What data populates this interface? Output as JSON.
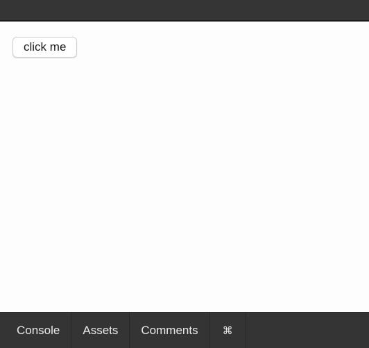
{
  "preview": {
    "button_label": "click me"
  },
  "bottom_tabs": {
    "console": "Console",
    "assets": "Assets",
    "comments": "Comments",
    "shortcuts": "⌘"
  },
  "colors": {
    "top_bar": "#353535",
    "bottom_bar": "#343434",
    "preview_background": "#fdfdfd"
  }
}
